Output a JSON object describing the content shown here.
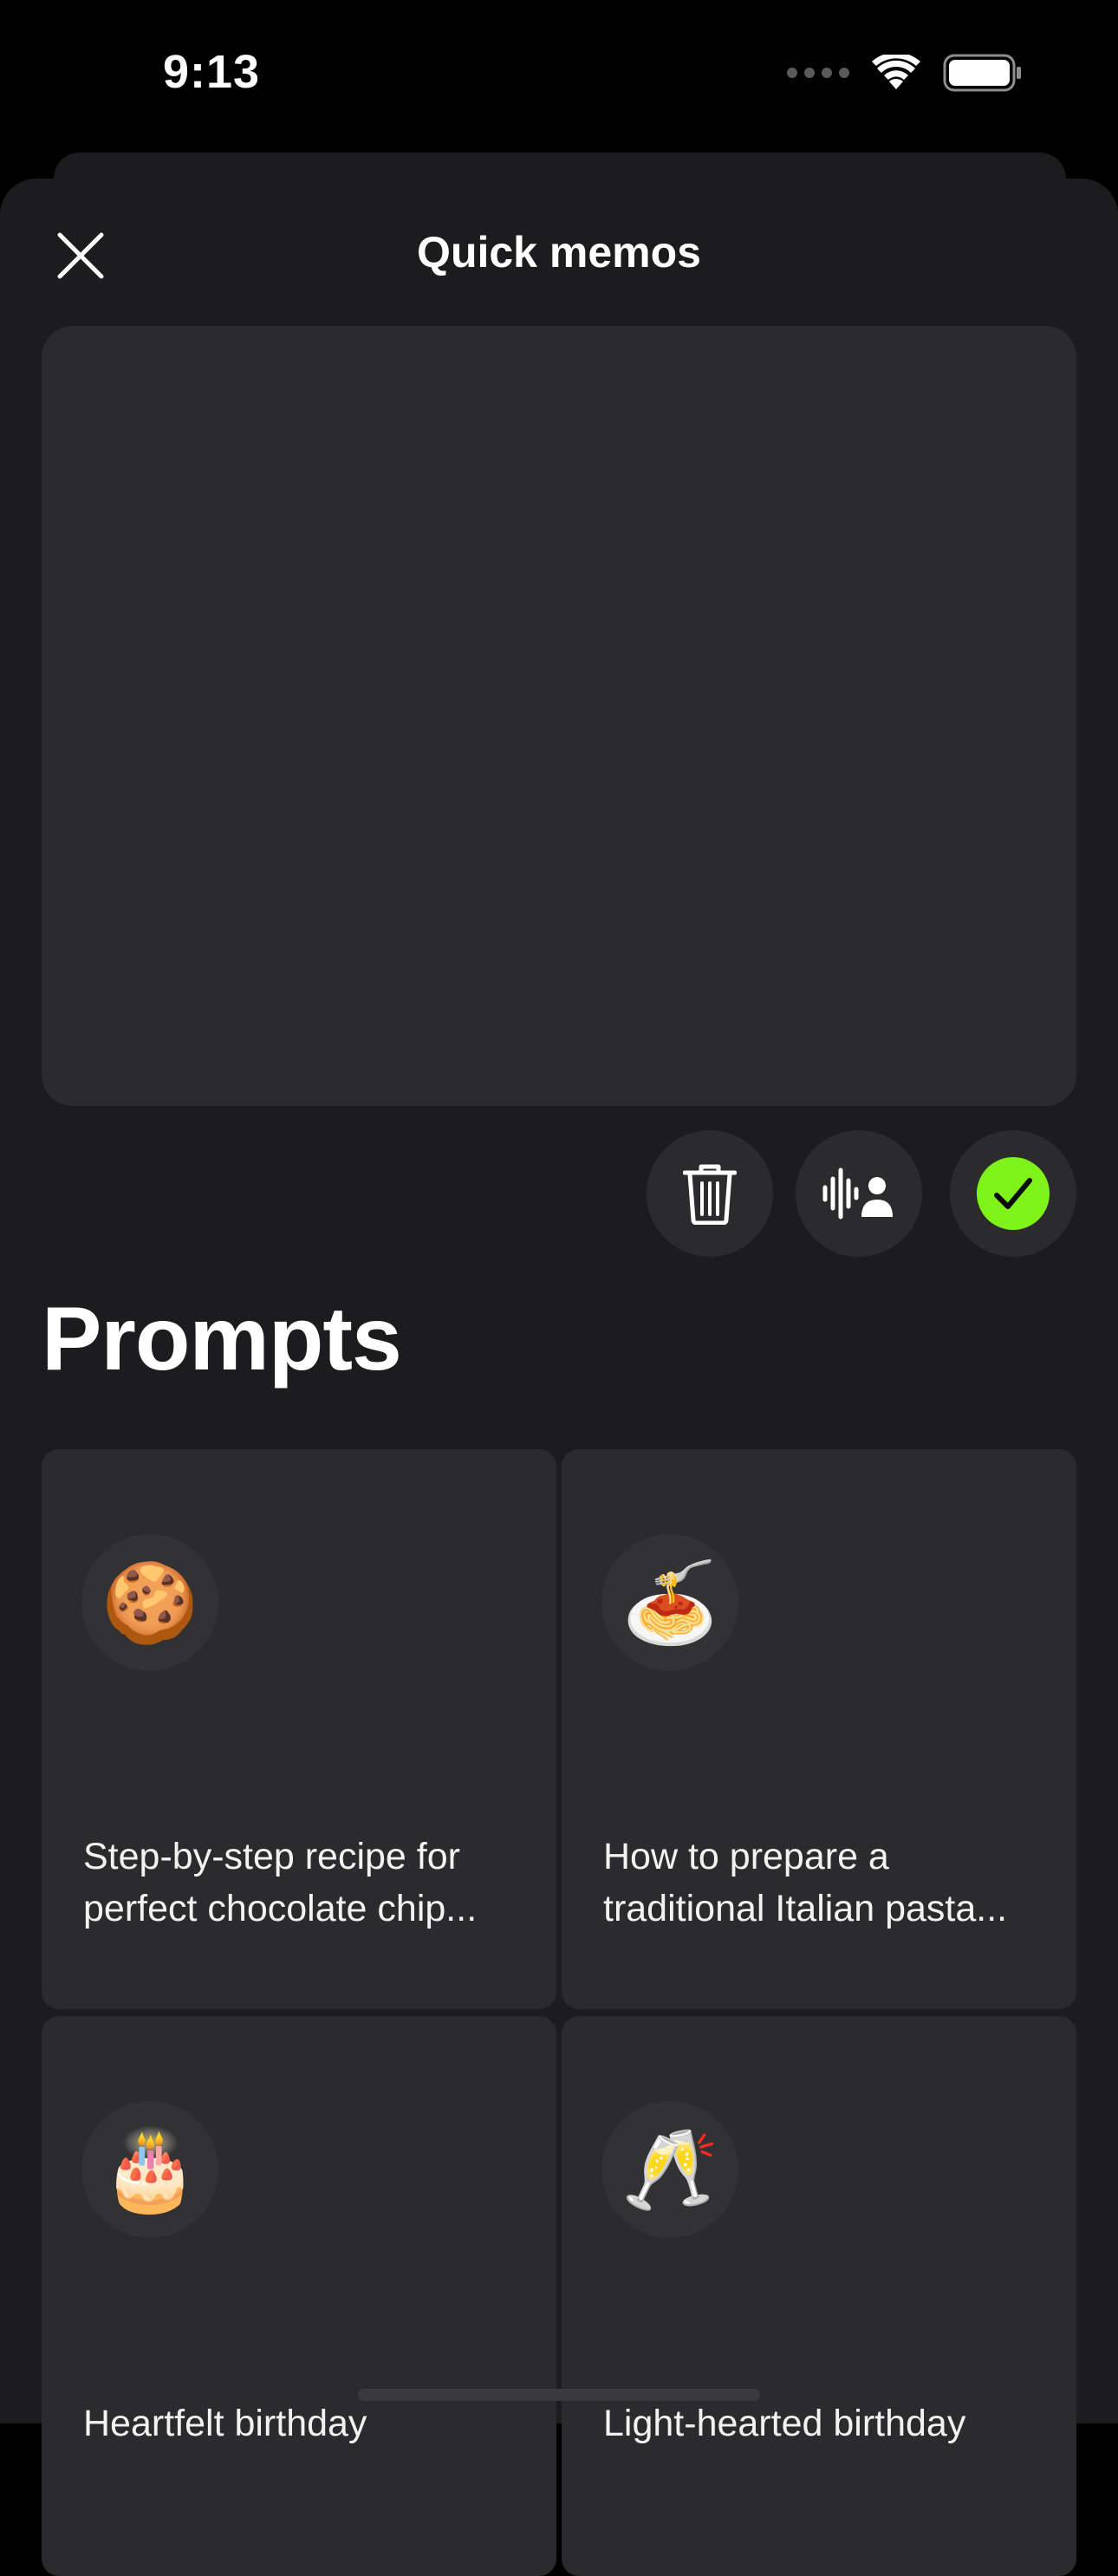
{
  "status_bar": {
    "time": "9:13",
    "icons": [
      "signal-dots-icon",
      "wifi-icon",
      "battery-icon"
    ]
  },
  "sheet": {
    "title": "Quick memos",
    "close_icon": "close-icon",
    "memo_text": "",
    "actions": [
      {
        "name": "delete",
        "icon": "trash-icon"
      },
      {
        "name": "voice",
        "icon": "voice-person-icon"
      },
      {
        "name": "confirm",
        "icon": "checkmark-icon",
        "color": "#7ff319"
      }
    ]
  },
  "prompts": {
    "heading": "Prompts",
    "items": [
      {
        "emoji": "🍪",
        "text": "Step-by-step recipe for perfect chocolate chip..."
      },
      {
        "emoji": "🍝",
        "text": "How to prepare a traditional Italian pasta..."
      },
      {
        "emoji": "🎂",
        "text": "Heartfelt birthday"
      },
      {
        "emoji": "🥂",
        "text": "Light-hearted birthday"
      }
    ]
  }
}
